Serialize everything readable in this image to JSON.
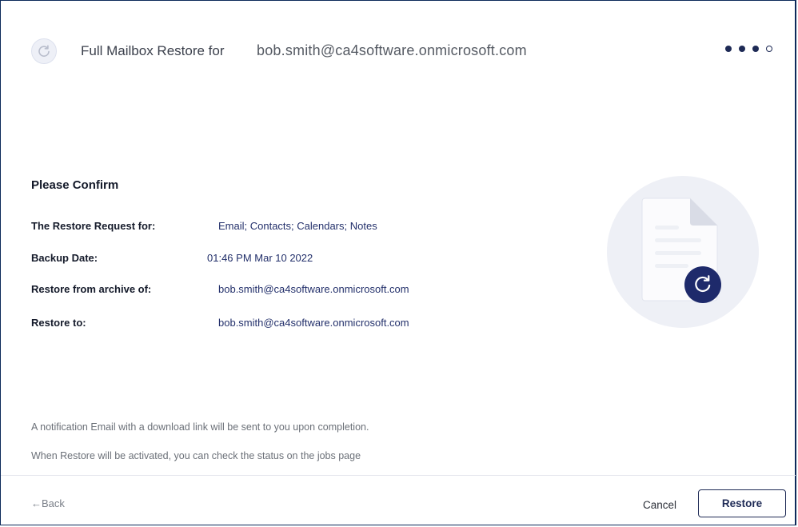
{
  "header": {
    "title_prefix": "Full Mailbox Restore for",
    "title_email": "bob.smith@ca4software.onmicrosoft.com",
    "steps": {
      "total": 4,
      "completed": 3
    }
  },
  "confirm": {
    "heading": "Please Confirm",
    "rows": [
      {
        "label": "The Restore Request for:",
        "value": "Email; Contacts; Calendars; Notes"
      },
      {
        "label": "Backup Date:",
        "value": "01:46 PM Mar 10 2022"
      },
      {
        "label": "Restore from archive of:",
        "value": "bob.smith@ca4software.onmicrosoft.com"
      },
      {
        "label": "Restore to:",
        "value": "bob.smith@ca4software.onmicrosoft.com"
      }
    ]
  },
  "notes": [
    "A notification Email with a download link will be sent to you upon completion.",
    "When Restore will be activated, you can check the status on the jobs page"
  ],
  "footer": {
    "back_label": "←Back",
    "cancel_label": "Cancel",
    "restore_label": "Restore"
  },
  "colors": {
    "accent": "#1e2a55",
    "value_text": "#23306b",
    "illustration_bg": "#eef0f6"
  },
  "icons": {
    "header": "refresh-icon",
    "illustration": "document-icon",
    "badge": "restore-icon"
  }
}
